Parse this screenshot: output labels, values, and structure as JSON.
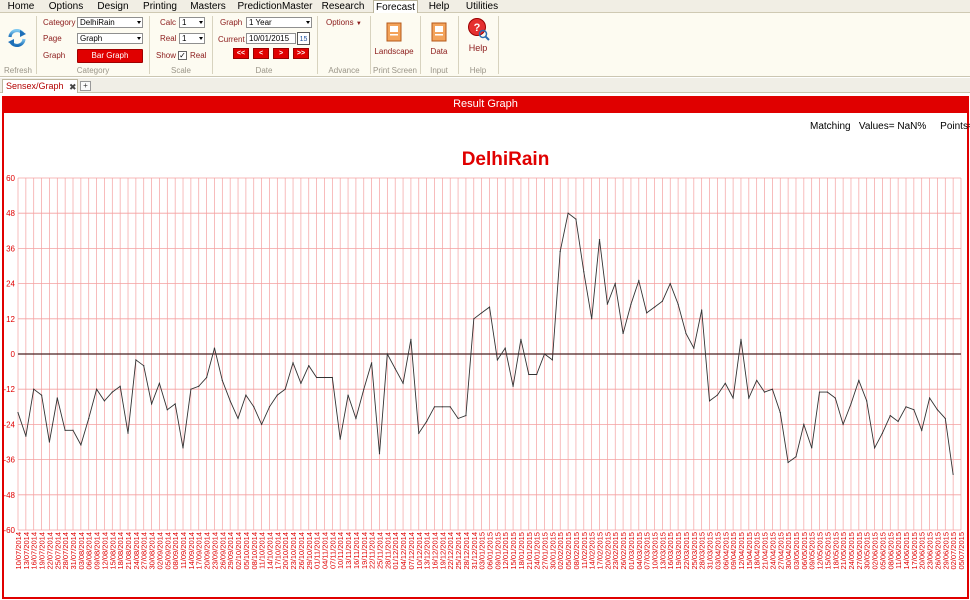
{
  "menu": {
    "tabs": [
      "Home",
      "Options",
      "Design",
      "Printing",
      "Masters",
      "PredictionMaster",
      "Research",
      "Forecast",
      "Help",
      "Utilities"
    ],
    "active": "Forecast"
  },
  "ribbon": {
    "refresh_label": "Refresh",
    "category_group": {
      "category_label": "Category",
      "category_value": "DelhiRain",
      "page_label": "Page",
      "page_value": "Graph",
      "graph_label": "Graph",
      "graph_button": "Bar Graph",
      "group_label": "Category"
    },
    "scale_group": {
      "calc_label": "Calc",
      "calc_value": "1",
      "real_label": "Real",
      "real_value": "1",
      "show_label": "Show",
      "show_check_label": "Real",
      "show_checked": true,
      "group_label": "Scale"
    },
    "date_group": {
      "graph_label": "Graph",
      "graph_value": "1 Year",
      "current_label": "Current",
      "current_value": "10/01/2015",
      "calendar_day": "15",
      "nav": [
        "<<",
        "<",
        ">",
        ">>"
      ],
      "group_label": "Date"
    },
    "advance_group": {
      "options_label": "Options",
      "group_label": "Advance"
    },
    "print_group": {
      "landscape_label": "Landscape",
      "group_label": "Print Screen"
    },
    "input_group": {
      "data_label": "Data",
      "group_label": "Input"
    },
    "help_group": {
      "help_label": "Help",
      "group_label": "Help"
    }
  },
  "document_tab": {
    "title": "Sensex/Graph",
    "close_glyph": "✖",
    "new_glyph": "+"
  },
  "result": {
    "header": "Result Graph",
    "matching_text": "Matching   Values= NaN%     Points=NaN%"
  },
  "colors": {
    "accent": "#e00000",
    "grid": "#f4a0a0",
    "line": "#333333",
    "zero_line": "#4a2020"
  },
  "chart_data": {
    "type": "line",
    "title": "DelhiRain",
    "ylim": [
      -60,
      60
    ],
    "yticks": [
      60,
      48,
      36,
      24,
      12,
      0,
      -12,
      -24,
      -36,
      -48,
      -60
    ],
    "grid": true,
    "x": [
      "10/07/2014",
      "13/07/2014",
      "16/07/2014",
      "19/07/2014",
      "22/07/2014",
      "25/07/2014",
      "28/07/2014",
      "31/07/2014",
      "03/08/2014",
      "06/08/2014",
      "09/08/2014",
      "12/08/2014",
      "15/08/2014",
      "18/08/2014",
      "21/08/2014",
      "24/08/2014",
      "27/08/2014",
      "30/08/2014",
      "02/09/2014",
      "05/09/2014",
      "08/09/2014",
      "11/09/2014",
      "14/09/2014",
      "17/09/2014",
      "20/09/2014",
      "23/09/2014",
      "26/09/2014",
      "29/09/2014",
      "02/10/2014",
      "05/10/2014",
      "08/10/2014",
      "11/10/2014",
      "14/10/2014",
      "17/10/2014",
      "20/10/2014",
      "23/10/2014",
      "26/10/2014",
      "29/10/2014",
      "01/11/2014",
      "04/11/2014",
      "07/11/2014",
      "10/11/2014",
      "13/11/2014",
      "16/11/2014",
      "19/11/2014",
      "22/11/2014",
      "25/11/2014",
      "28/11/2014",
      "01/12/2014",
      "04/12/2014",
      "07/12/2014",
      "10/12/2014",
      "13/12/2014",
      "16/12/2014",
      "19/12/2014",
      "22/12/2014",
      "25/12/2014",
      "28/12/2014",
      "31/12/2014",
      "03/01/2015",
      "06/01/2015",
      "09/01/2015",
      "12/01/2015",
      "15/01/2015",
      "18/01/2015",
      "21/01/2015",
      "24/01/2015",
      "27/01/2015",
      "30/01/2015",
      "02/02/2015",
      "05/02/2015",
      "08/02/2015",
      "11/02/2015",
      "14/02/2015",
      "17/02/2015",
      "20/02/2015",
      "23/02/2015",
      "26/02/2015",
      "01/03/2015",
      "04/03/2015",
      "07/03/2015",
      "10/03/2015",
      "13/03/2015",
      "16/03/2015",
      "19/03/2015",
      "22/03/2015",
      "25/03/2015",
      "28/03/2015",
      "31/03/2015",
      "03/04/2015",
      "06/04/2015",
      "09/04/2015",
      "12/04/2015",
      "15/04/2015",
      "18/04/2015",
      "21/04/2015",
      "24/04/2015",
      "27/04/2015",
      "30/04/2015",
      "03/05/2015",
      "06/05/2015",
      "09/05/2015",
      "12/05/2015",
      "15/05/2015",
      "18/05/2015",
      "21/05/2015",
      "24/05/2015",
      "27/05/2015",
      "30/05/2015",
      "02/06/2015",
      "05/06/2015",
      "08/06/2015",
      "11/06/2015",
      "14/06/2015",
      "17/06/2015",
      "20/06/2015",
      "23/06/2015",
      "26/06/2015",
      "29/06/2015",
      "02/07/2015",
      "05/07/2015"
    ],
    "series": [
      {
        "values": [
          -20,
          -28,
          -12,
          -14,
          -30,
          -15,
          -26,
          -26,
          -31,
          -22,
          -12,
          -16,
          -13,
          -11,
          -27,
          -2,
          -4,
          -17,
          -10,
          -19,
          -17,
          -32,
          -12,
          -11,
          -8,
          2,
          -9,
          -16,
          -22,
          -14,
          -18,
          -24,
          -18,
          -14,
          -12,
          -3,
          -10,
          -4,
          -8,
          -8,
          -8,
          -29,
          -14,
          -22,
          -12,
          -3,
          -34,
          0,
          -5,
          -10,
          5,
          -27,
          -23,
          -18,
          -18,
          -18,
          -22,
          -21,
          12,
          14,
          16,
          -2,
          2,
          -11,
          5,
          -7,
          -7,
          0,
          -2,
          35,
          48,
          46,
          28,
          12,
          39,
          17,
          24,
          7,
          17,
          25,
          14,
          16,
          18,
          24,
          17,
          7,
          2,
          15,
          -16,
          -14,
          -10,
          -15,
          5,
          -15,
          -9,
          -13,
          -12,
          -20,
          -37,
          -35,
          -24,
          -32,
          -13,
          -13,
          -15,
          -24,
          -17,
          -9,
          -16,
          -32,
          -27,
          -21,
          -23,
          -18,
          -19,
          -26,
          -15,
          -19,
          -22,
          -41
        ]
      }
    ]
  }
}
